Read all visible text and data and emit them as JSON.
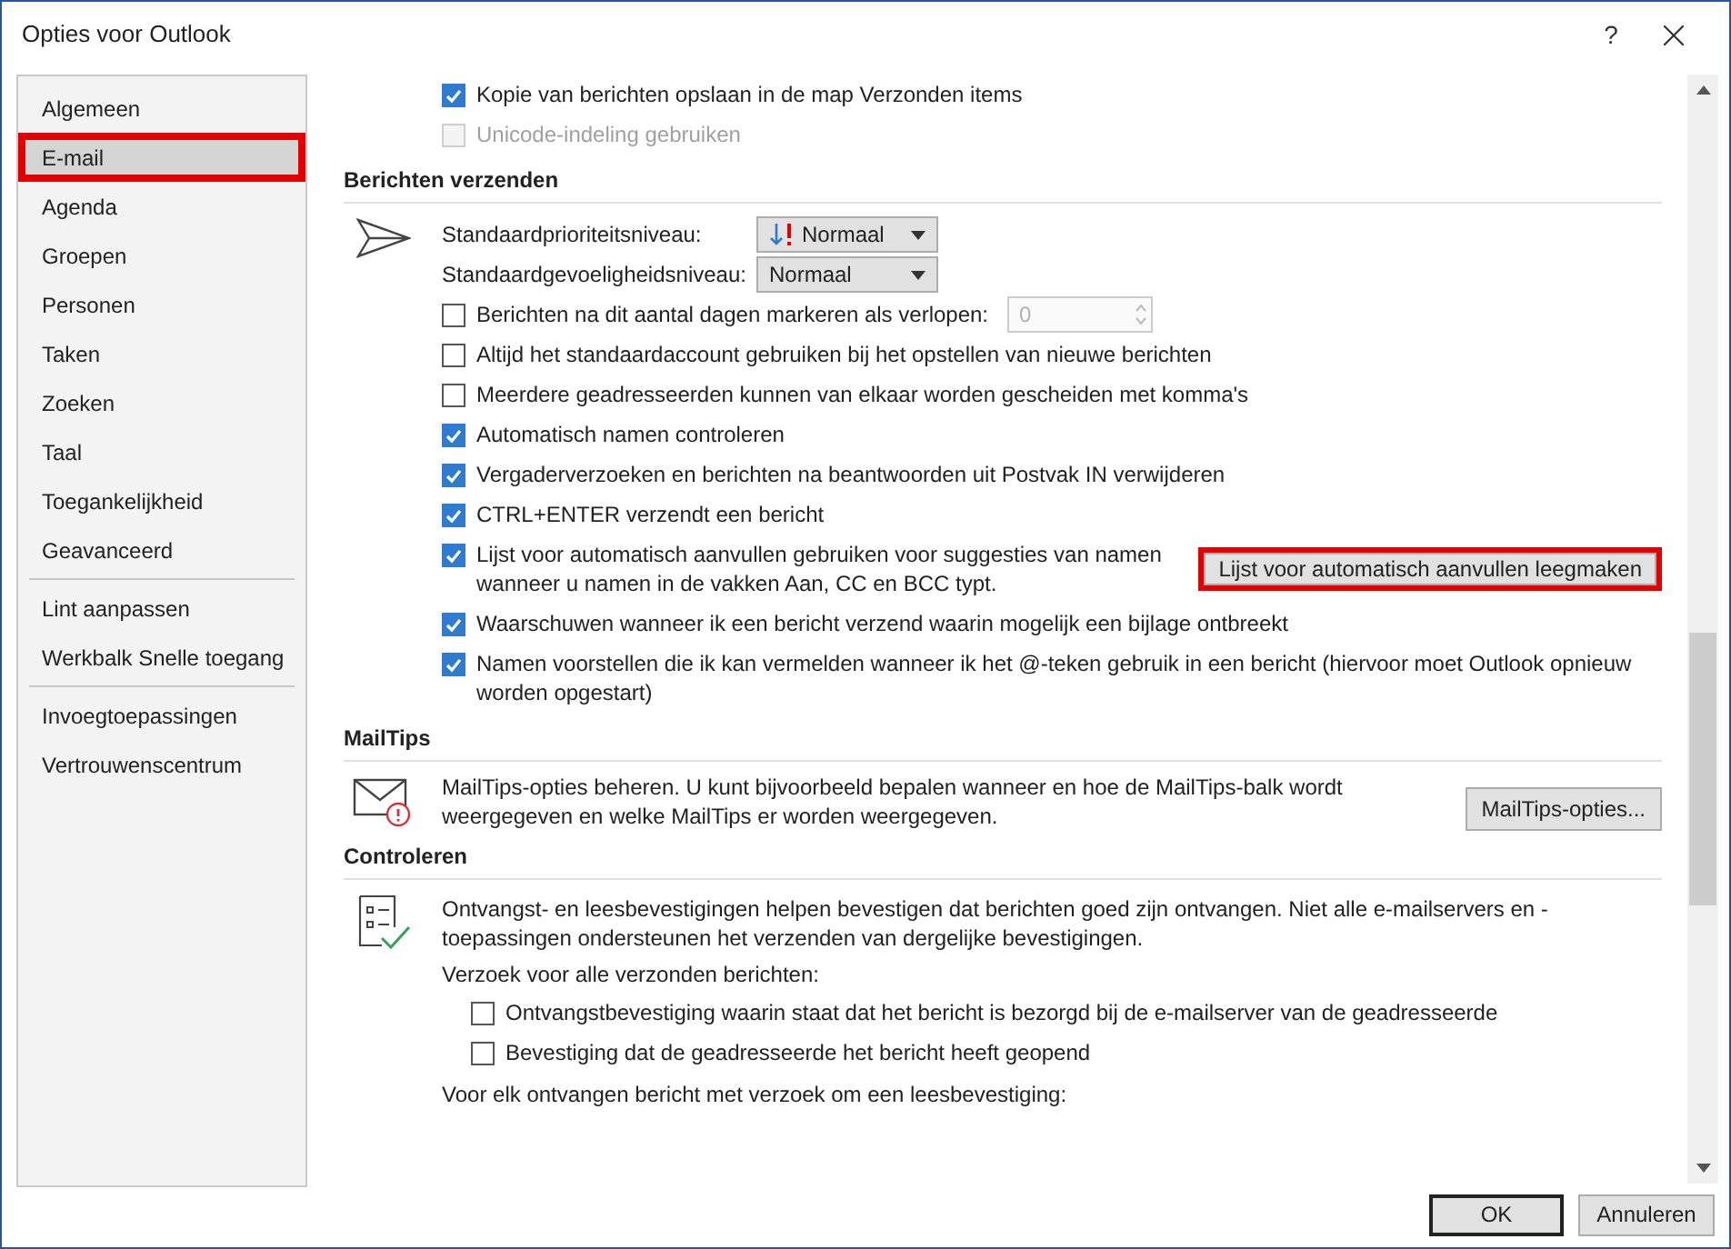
{
  "window": {
    "title": "Opties voor Outlook",
    "help": "?"
  },
  "sidebar": {
    "groups": [
      [
        {
          "label": "Algemeen",
          "selected": false,
          "highlighted": false
        },
        {
          "label": "E-mail",
          "selected": true,
          "highlighted": true
        },
        {
          "label": "Agenda",
          "selected": false,
          "highlighted": false
        },
        {
          "label": "Groepen",
          "selected": false,
          "highlighted": false
        },
        {
          "label": "Personen",
          "selected": false,
          "highlighted": false
        },
        {
          "label": "Taken",
          "selected": false,
          "highlighted": false
        },
        {
          "label": "Zoeken",
          "selected": false,
          "highlighted": false
        },
        {
          "label": "Taal",
          "selected": false,
          "highlighted": false
        },
        {
          "label": "Toegankelijkheid",
          "selected": false,
          "highlighted": false
        },
        {
          "label": "Geavanceerd",
          "selected": false,
          "highlighted": false
        }
      ],
      [
        {
          "label": "Lint aanpassen",
          "selected": false,
          "highlighted": false
        },
        {
          "label": "Werkbalk Snelle toegang",
          "selected": false,
          "highlighted": false
        }
      ],
      [
        {
          "label": "Invoegtoepassingen",
          "selected": false,
          "highlighted": false
        },
        {
          "label": "Vertrouwenscentrum",
          "selected": false,
          "highlighted": false
        }
      ]
    ]
  },
  "sections": [
    {
      "rows": [
        {
          "kind": "checkbox",
          "label": "Kopie van berichten opslaan in de map Verzonden items",
          "checked": true,
          "disabled": false
        },
        {
          "kind": "checkbox",
          "label": "Unicode-indeling gebruiken",
          "checked": false,
          "disabled": true
        }
      ]
    },
    {
      "heading": "Berichten verzenden",
      "kind": "send",
      "rows": [
        {
          "kind": "priority_dropdown",
          "label": "Standaardprioriteitsniveau:",
          "value": "Normaal"
        },
        {
          "kind": "dropdown",
          "label": "Standaardgevoeligheidsniveau:",
          "value": "Normaal"
        },
        {
          "kind": "checkbox_spin",
          "label": "Berichten na dit aantal dagen markeren als verlopen:",
          "checked": false,
          "disabled": false,
          "spin": {
            "value": "0",
            "disabled": true
          }
        },
        {
          "kind": "checkbox",
          "label": "Altijd het standaardaccount gebruiken bij het opstellen van nieuwe berichten",
          "checked": false,
          "disabled": false
        },
        {
          "kind": "checkbox",
          "label": "Meerdere geadresseerden kunnen van elkaar worden gescheiden met komma's",
          "checked": false,
          "disabled": false
        },
        {
          "kind": "checkbox",
          "label": "Automatisch namen controleren",
          "checked": true,
          "disabled": false
        },
        {
          "kind": "checkbox",
          "label": "Vergaderverzoeken en berichten na beantwoorden uit Postvak IN verwijderen",
          "checked": true,
          "disabled": false
        },
        {
          "kind": "checkbox",
          "label": "CTRL+ENTER verzendt een bericht",
          "checked": true,
          "disabled": false
        },
        {
          "kind": "checkbox_button",
          "label": "Lijst voor automatisch aanvullen gebruiken voor suggesties van namen wanneer u namen in de vakken Aan, CC en BCC typt.",
          "checked": true,
          "disabled": false,
          "button": {
            "label": "Lijst voor automatisch aanvullen leegmaken",
            "highlighted": true
          }
        },
        {
          "kind": "checkbox",
          "label": "Waarschuwen wanneer ik een bericht verzend waarin mogelijk een bijlage ontbreekt",
          "checked": true,
          "disabled": false
        },
        {
          "kind": "checkbox",
          "label": "Namen voorstellen die ik kan vermelden wanneer ik het @-teken gebruik in een bericht (hiervoor moet Outlook opnieuw worden opgestart)",
          "checked": true,
          "disabled": false
        }
      ]
    },
    {
      "heading": "MailTips",
      "kind": "mail",
      "rows": [
        {
          "kind": "text_button",
          "text": "MailTips-opties beheren. U kunt bijvoorbeeld bepalen wanneer en hoe de MailTips-balk wordt weergegeven en welke MailTips er worden weergegeven.",
          "button": {
            "label": "MailTips-opties...",
            "highlighted": false
          }
        }
      ]
    },
    {
      "heading": "Controleren",
      "kind": "checklist",
      "rows": [
        {
          "kind": "text",
          "text": "Ontvangst- en leesbevestigingen helpen bevestigen dat berichten goed zijn ontvangen. Niet alle e-mailservers en -toepassingen ondersteunen het verzenden van dergelijke bevestigingen."
        },
        {
          "kind": "text",
          "text": "Verzoek voor alle verzonden berichten:",
          "children": [
            {
              "kind": "checkbox",
              "label": "Ontvangstbevestiging waarin staat dat het bericht is bezorgd bij de e-mailserver van de geadresseerde",
              "checked": false,
              "disabled": false
            },
            {
              "kind": "checkbox",
              "label": "Bevestiging dat de geadresseerde het bericht heeft geopend",
              "checked": false,
              "disabled": false
            }
          ]
        },
        {
          "kind": "text",
          "text": "Voor elk ontvangen bericht met verzoek om een leesbevestiging:"
        }
      ]
    }
  ],
  "footer": {
    "buttons": [
      {
        "label": "OK",
        "default": true
      },
      {
        "label": "Annuleren",
        "default": false
      }
    ]
  }
}
